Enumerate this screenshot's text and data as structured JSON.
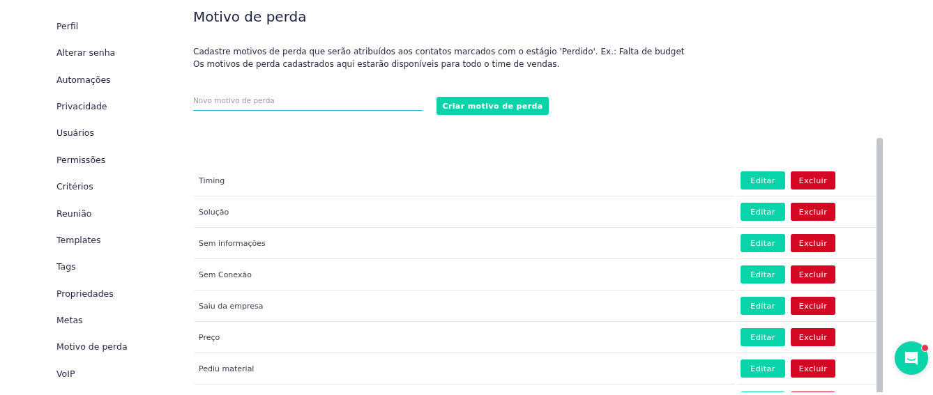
{
  "sidebar": {
    "items": [
      {
        "label": "Perfil"
      },
      {
        "label": "Alterar senha"
      },
      {
        "label": "Automações"
      },
      {
        "label": "Privacidade"
      },
      {
        "label": "Usuários"
      },
      {
        "label": "Permissões"
      },
      {
        "label": "Critérios"
      },
      {
        "label": "Reunião"
      },
      {
        "label": "Templates"
      },
      {
        "label": "Tags"
      },
      {
        "label": "Propriedades"
      },
      {
        "label": "Metas"
      },
      {
        "label": "Motivo de perda"
      },
      {
        "label": "VoIP"
      }
    ]
  },
  "page": {
    "title": "Motivo de perda",
    "description": [
      "Cadastre motivos de perda que serão atribuídos aos contatos marcados com o estágio 'Perdido'. Ex.: Falta de budget",
      "Os motivos de perda cadastrados aqui estarão disponíveis para todo o time de vendas."
    ]
  },
  "form": {
    "placeholder": "Novo motivo de perda",
    "button": "Criar motivo de perda"
  },
  "table": {
    "rows": [
      {
        "kind": "full",
        "label": "Timing",
        "edit": "Editar",
        "delete": "Excluir"
      },
      {
        "kind": "full",
        "label": "Solução",
        "edit": "Editar",
        "delete": "Excluir"
      },
      {
        "kind": "full",
        "label": "Sem informações",
        "edit": "Editar",
        "delete": "Excluir"
      },
      {
        "kind": "full",
        "label": "Sem Conexão",
        "edit": "Editar",
        "delete": "Excluir"
      },
      {
        "kind": "full",
        "label": "Saiu da empresa",
        "edit": "Editar",
        "delete": "Excluir"
      },
      {
        "kind": "full",
        "label": "Preço",
        "edit": "Editar",
        "delete": "Excluir"
      },
      {
        "kind": "full",
        "label": "Pediu material",
        "edit": "Editar",
        "delete": "Excluir"
      },
      {
        "kind": "cut"
      }
    ]
  },
  "chat": {
    "unread": true
  }
}
